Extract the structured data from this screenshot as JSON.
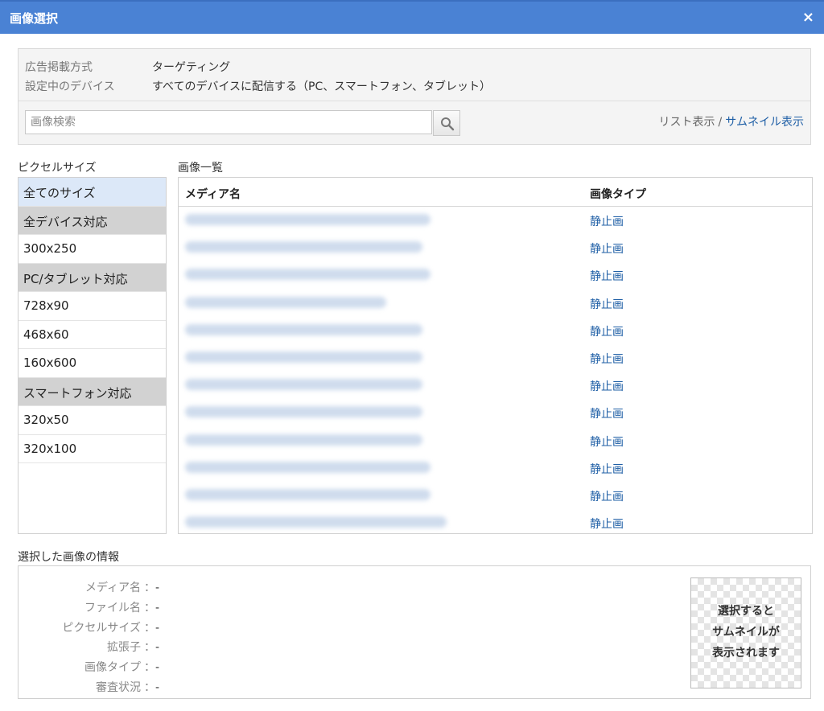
{
  "window": {
    "title": "画像選択",
    "close_label": "×"
  },
  "settings": {
    "ad_method_label": "広告掲載方式",
    "ad_method_value": "ターゲティング",
    "device_label": "設定中のデバイス",
    "device_value": "すべてのデバイスに配信する（PC、スマートフォン、タブレット）"
  },
  "search": {
    "placeholder": "画像検索",
    "button_icon": "search-icon"
  },
  "view_toggle": {
    "list_label": "リスト表示",
    "separator": "/",
    "thumbnail_label": "サムネイル表示"
  },
  "sizes": {
    "title": "ピクセルサイズ",
    "items": [
      {
        "label": "全てのサイズ"
      },
      {
        "label": "全デバイス対応"
      },
      {
        "label": "300x250"
      },
      {
        "label": "PC/タブレット対応"
      },
      {
        "label": "728x90"
      },
      {
        "label": "468x60"
      },
      {
        "label": "160x600"
      },
      {
        "label": "スマートフォン対応"
      },
      {
        "label": "320x50"
      },
      {
        "label": "320x100"
      }
    ]
  },
  "images": {
    "title": "画像一覧",
    "columns": {
      "name": "メディア名",
      "type": "画像タイプ"
    },
    "rows": [
      {
        "type": "静止画"
      },
      {
        "type": "静止画"
      },
      {
        "type": "静止画"
      },
      {
        "type": "静止画"
      },
      {
        "type": "静止画"
      },
      {
        "type": "静止画"
      },
      {
        "type": "静止画"
      },
      {
        "type": "静止画"
      },
      {
        "type": "静止画"
      },
      {
        "type": "静止画"
      },
      {
        "type": "静止画"
      },
      {
        "type": "静止画"
      }
    ]
  },
  "info": {
    "title": "選択した画像の情報",
    "separator": "：",
    "fields": [
      {
        "label": "メディア名",
        "value": "-"
      },
      {
        "label": "ファイル名",
        "value": "-"
      },
      {
        "label": "ピクセルサイズ",
        "value": "-"
      },
      {
        "label": "拡張子",
        "value": "-"
      },
      {
        "label": "画像タイプ",
        "value": "-"
      },
      {
        "label": "審査状況",
        "value": "-"
      }
    ],
    "thumbnail_lines": [
      "選択すると",
      "サムネイルが",
      "表示されます"
    ]
  }
}
